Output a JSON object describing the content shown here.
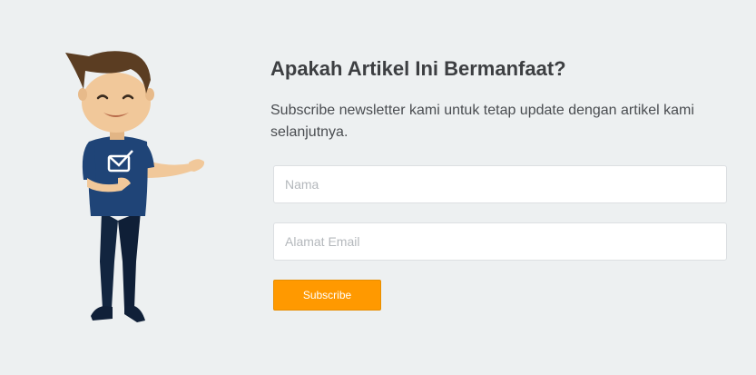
{
  "newsletter": {
    "title": "Apakah Artikel Ini Bermanfaat?",
    "subtitle": "Subscribe newsletter kami untuk tetap update dengan artikel kami selanjutnya.",
    "name_placeholder": "Nama",
    "email_placeholder": "Alamat Email",
    "subscribe_label": "Subscribe"
  },
  "colors": {
    "background": "#edf0f1",
    "button": "#ff9900",
    "shirt": "#1f4477",
    "pants": "#12253f",
    "hair": "#5b3d22",
    "skin": "#f1c89a"
  },
  "mascot": {
    "icon": "mascot-illustration"
  }
}
